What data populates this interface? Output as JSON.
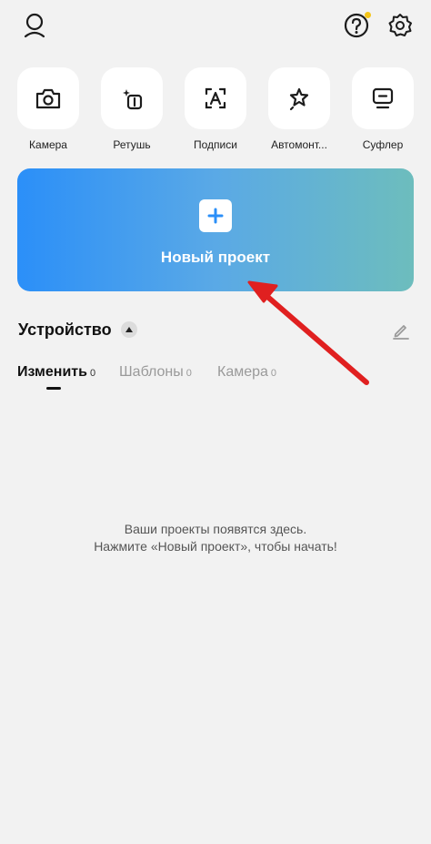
{
  "header": {
    "profile_icon": "person-icon",
    "help_icon": "help-circle-icon",
    "settings_icon": "gear-icon",
    "notification_color": "#f5c518"
  },
  "tools": [
    {
      "label": "Камера",
      "icon": "camera-icon"
    },
    {
      "label": "Ретушь",
      "icon": "retouch-icon"
    },
    {
      "label": "Подписи",
      "icon": "captions-icon"
    },
    {
      "label": "Автомонт...",
      "icon": "automontage-icon"
    },
    {
      "label": "Суфлер",
      "icon": "teleprompter-icon"
    }
  ],
  "new_project": {
    "label": "Новый проект",
    "icon": "plus-icon",
    "gradient": [
      "#2b8ff8",
      "#6dbdbd"
    ]
  },
  "section": {
    "title": "Устройство",
    "edit_icon": "pencil-icon"
  },
  "tabs": [
    {
      "label": "Изменить",
      "count": "0"
    },
    {
      "label": "Шаблоны",
      "count": "0"
    },
    {
      "label": "Камера",
      "count": "0"
    }
  ],
  "empty_state": {
    "line1": "Ваши проекты появятся здесь.",
    "line2": "Нажмите «Новый проект», чтобы начать!"
  },
  "annotation": {
    "arrow_color": "#e02020"
  }
}
